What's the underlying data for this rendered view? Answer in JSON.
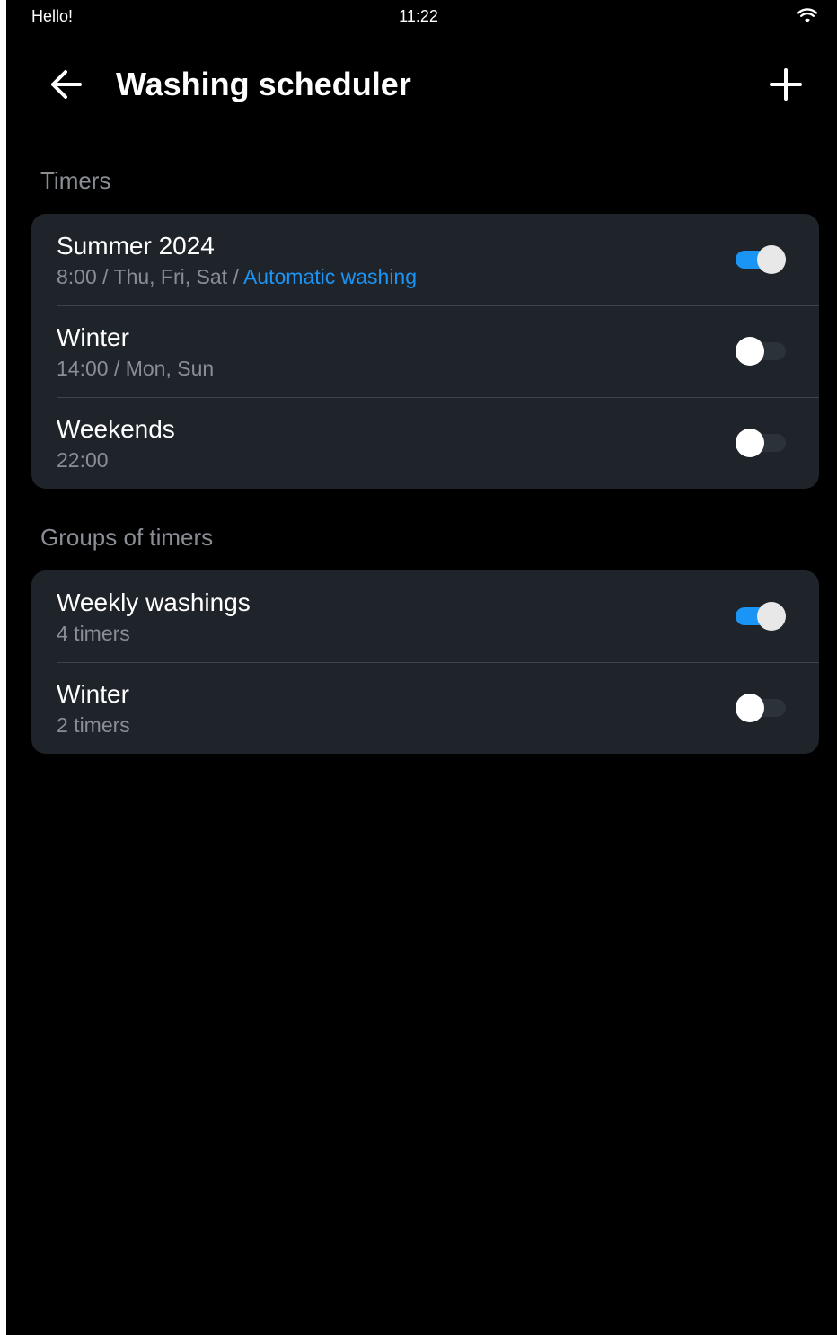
{
  "status_bar": {
    "left_text": "Hello!",
    "time": "11:22"
  },
  "app_bar": {
    "title": "Washing scheduler"
  },
  "timers_section": {
    "header": "Timers",
    "items": [
      {
        "title": "Summer 2024",
        "subtitle": "8:00 / Thu, Fri, Sat / ",
        "subtitle_accent": "Automatic washing",
        "enabled": true
      },
      {
        "title": "Winter",
        "subtitle": "14:00 / Mon, Sun",
        "subtitle_accent": "",
        "enabled": false
      },
      {
        "title": "Weekends",
        "subtitle": "22:00",
        "subtitle_accent": "",
        "enabled": false
      }
    ]
  },
  "groups_section": {
    "header": "Groups of timers",
    "items": [
      {
        "title": "Weekly washings",
        "subtitle": "4 timers",
        "enabled": true
      },
      {
        "title": "Winter",
        "subtitle": "2 timers",
        "enabled": false
      }
    ]
  },
  "colors": {
    "background": "#000000",
    "card": "#1f242b",
    "accent": "#1a95f5",
    "secondary_text": "#8a8e94"
  }
}
